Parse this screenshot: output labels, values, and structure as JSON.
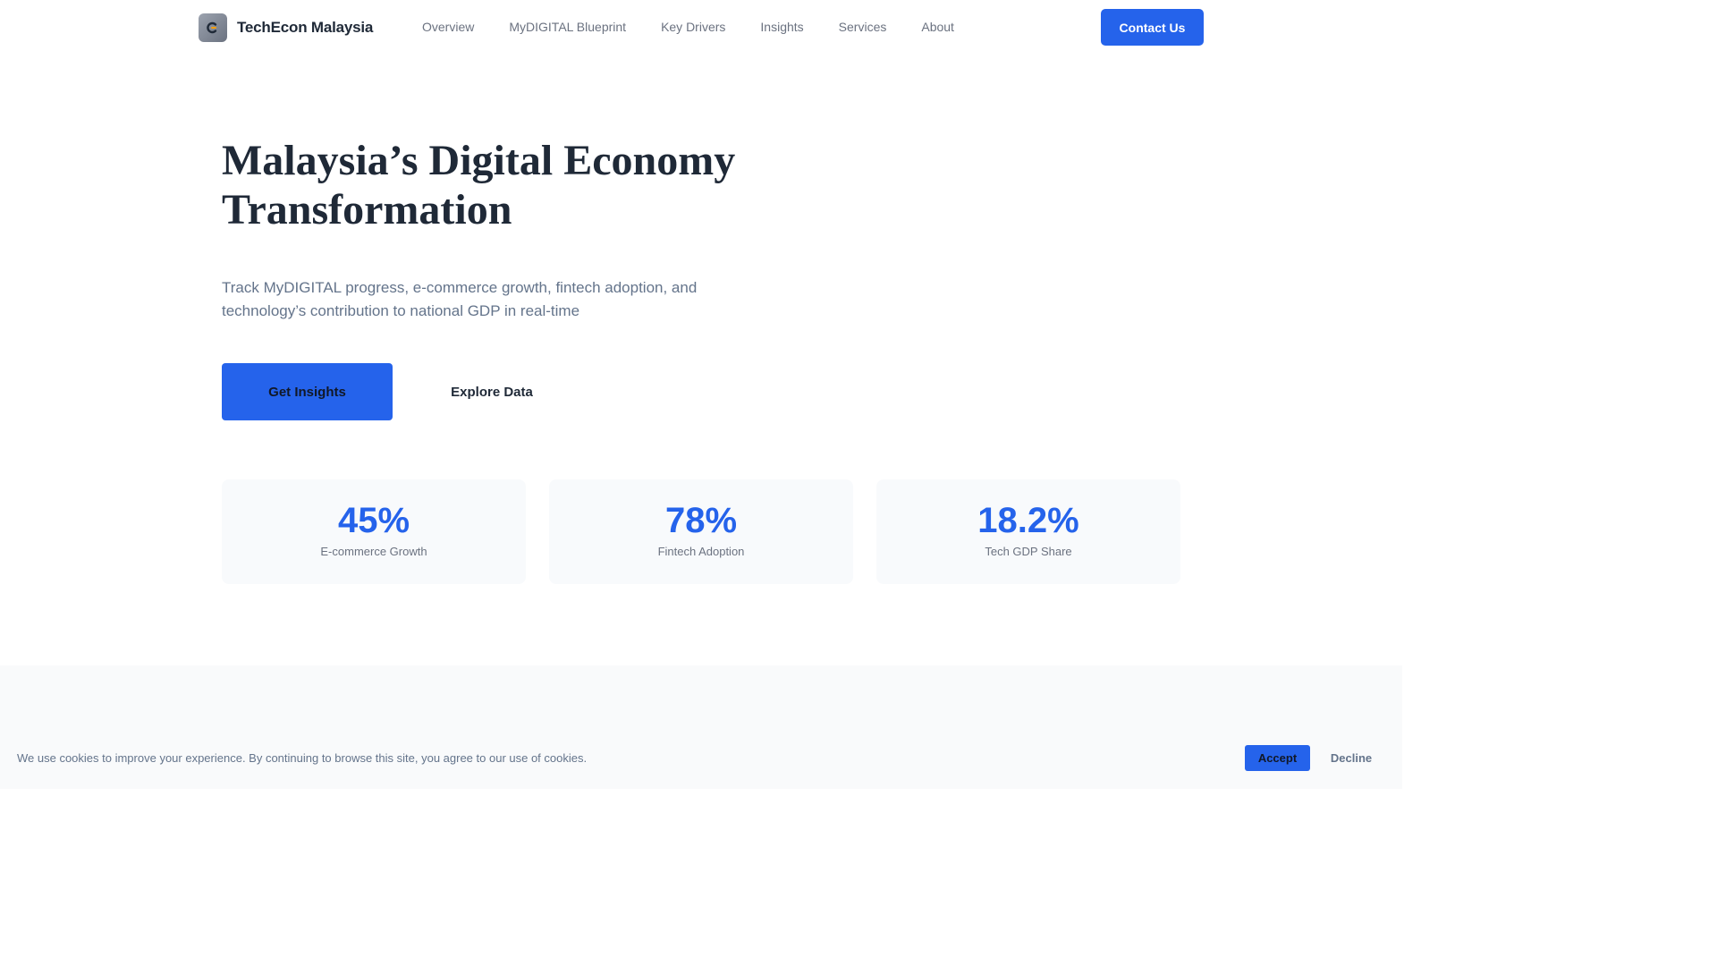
{
  "header": {
    "logo_icon": "techecon-logo-icon",
    "brand": "TechEcon Malaysia",
    "nav": [
      "Overview",
      "MyDIGITAL Blueprint",
      "Key Drivers",
      "Insights",
      "Services",
      "About"
    ],
    "contact_label": "Contact Us"
  },
  "hero": {
    "title_line1": "Malaysia’s Digital Economy",
    "title_line2": "Transformation",
    "subtitle_line1": "Track MyDIGITAL progress, e-commerce growth, fintech adoption, and",
    "subtitle_line2": "technology’s contribution to national GDP in real-time",
    "primary_cta": "Get Insights",
    "secondary_cta": "Explore Data"
  },
  "stats": [
    {
      "value": "45%",
      "label": "E-commerce Growth"
    },
    {
      "value": "78%",
      "label": "Fintech Adoption"
    },
    {
      "value": "18.2%",
      "label": "Tech GDP Share"
    }
  ],
  "cookie": {
    "message": "We use cookies to improve your experience. By continuing to browse this site, you agree to our use of cookies.",
    "accept": "Accept",
    "decline": "Decline"
  },
  "colors": {
    "accent": "#2563eb",
    "text_dark": "#1f2937",
    "text_muted": "#64748b",
    "card_bg": "#f8fafc"
  }
}
